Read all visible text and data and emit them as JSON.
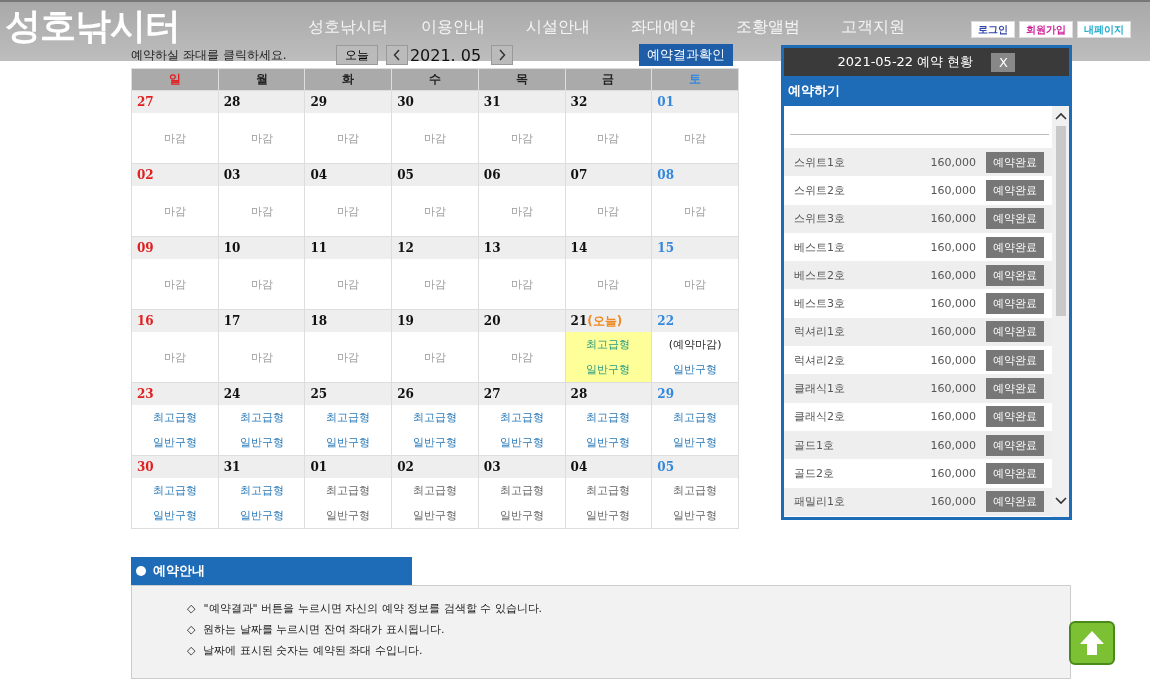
{
  "header": {
    "logo": "성호낚시터",
    "nav": [
      "성호낚시터",
      "이용안내",
      "시설안내",
      "좌대예약",
      "조황앨범",
      "고객지원"
    ],
    "account": [
      {
        "label": "로그인",
        "color": "#3344aa"
      },
      {
        "label": "회원가입",
        "color": "#cc2299"
      },
      {
        "label": "내페이지",
        "color": "#22aacc"
      }
    ]
  },
  "toolbar": {
    "hint": "예약하실 좌대를 클릭하세요.",
    "today_button": "오늘",
    "month": "2021. 05",
    "result_button": "예약결과확인"
  },
  "calendar": {
    "weekdays": [
      {
        "label": "일",
        "kind": "sun"
      },
      {
        "label": "월",
        "kind": "week"
      },
      {
        "label": "화",
        "kind": "week"
      },
      {
        "label": "수",
        "kind": "week"
      },
      {
        "label": "목",
        "kind": "week"
      },
      {
        "label": "금",
        "kind": "week"
      },
      {
        "label": "토",
        "kind": "sat"
      }
    ],
    "weeks": [
      [
        {
          "num": "27",
          "kind": "sun",
          "entries": [
            {
              "text": "마감",
              "kind": "closed"
            }
          ]
        },
        {
          "num": "28",
          "kind": "week",
          "entries": [
            {
              "text": "마감",
              "kind": "closed"
            }
          ]
        },
        {
          "num": "29",
          "kind": "week",
          "entries": [
            {
              "text": "마감",
              "kind": "closed"
            }
          ]
        },
        {
          "num": "30",
          "kind": "week",
          "entries": [
            {
              "text": "마감",
              "kind": "closed"
            }
          ]
        },
        {
          "num": "31",
          "kind": "week",
          "entries": [
            {
              "text": "마감",
              "kind": "closed"
            }
          ]
        },
        {
          "num": "32",
          "kind": "week",
          "entries": [
            {
              "text": "마감",
              "kind": "closed"
            }
          ]
        },
        {
          "num": "01",
          "kind": "sat",
          "entries": [
            {
              "text": "마감",
              "kind": "closed"
            }
          ]
        }
      ],
      [
        {
          "num": "02",
          "kind": "sun",
          "entries": [
            {
              "text": "마감",
              "kind": "closed"
            }
          ]
        },
        {
          "num": "03",
          "kind": "week",
          "entries": [
            {
              "text": "마감",
              "kind": "closed"
            }
          ]
        },
        {
          "num": "04",
          "kind": "week",
          "entries": [
            {
              "text": "마감",
              "kind": "closed"
            }
          ]
        },
        {
          "num": "05",
          "kind": "week",
          "entries": [
            {
              "text": "마감",
              "kind": "closed"
            }
          ]
        },
        {
          "num": "06",
          "kind": "week",
          "entries": [
            {
              "text": "마감",
              "kind": "closed"
            }
          ]
        },
        {
          "num": "07",
          "kind": "week",
          "entries": [
            {
              "text": "마감",
              "kind": "closed"
            }
          ]
        },
        {
          "num": "08",
          "kind": "sat",
          "entries": [
            {
              "text": "마감",
              "kind": "closed"
            }
          ]
        }
      ],
      [
        {
          "num": "09",
          "kind": "sun",
          "entries": [
            {
              "text": "마감",
              "kind": "closed"
            }
          ]
        },
        {
          "num": "10",
          "kind": "week",
          "entries": [
            {
              "text": "마감",
              "kind": "closed"
            }
          ]
        },
        {
          "num": "11",
          "kind": "week",
          "entries": [
            {
              "text": "마감",
              "kind": "closed"
            }
          ]
        },
        {
          "num": "12",
          "kind": "week",
          "entries": [
            {
              "text": "마감",
              "kind": "closed"
            }
          ]
        },
        {
          "num": "13",
          "kind": "week",
          "entries": [
            {
              "text": "마감",
              "kind": "closed"
            }
          ]
        },
        {
          "num": "14",
          "kind": "week",
          "entries": [
            {
              "text": "마감",
              "kind": "closed"
            }
          ]
        },
        {
          "num": "15",
          "kind": "sat",
          "entries": [
            {
              "text": "마감",
              "kind": "closed"
            }
          ]
        }
      ],
      [
        {
          "num": "16",
          "kind": "sun",
          "entries": [
            {
              "text": "마감",
              "kind": "closed"
            }
          ]
        },
        {
          "num": "17",
          "kind": "week",
          "entries": [
            {
              "text": "마감",
              "kind": "closed"
            }
          ]
        },
        {
          "num": "18",
          "kind": "week",
          "entries": [
            {
              "text": "마감",
              "kind": "closed"
            }
          ]
        },
        {
          "num": "19",
          "kind": "week",
          "entries": [
            {
              "text": "마감",
              "kind": "closed"
            }
          ]
        },
        {
          "num": "20",
          "kind": "week",
          "entries": [
            {
              "text": "마감",
              "kind": "closed"
            }
          ]
        },
        {
          "num": "21",
          "kind": "week",
          "today_label": "(오늘)",
          "today": true,
          "entries": [
            {
              "text": "최고급형",
              "kind": "open"
            },
            {
              "text": "일반구형",
              "kind": "open"
            }
          ]
        },
        {
          "num": "22",
          "kind": "sat",
          "entries": [
            {
              "text": "(예약마감)",
              "kind": "full"
            },
            {
              "text": "일반구형",
              "kind": "open"
            }
          ]
        }
      ],
      [
        {
          "num": "23",
          "kind": "sun",
          "entries": [
            {
              "text": "최고급형",
              "kind": "open"
            },
            {
              "text": "일반구형",
              "kind": "open"
            }
          ]
        },
        {
          "num": "24",
          "kind": "week",
          "entries": [
            {
              "text": "최고급형",
              "kind": "open"
            },
            {
              "text": "일반구형",
              "kind": "open"
            }
          ]
        },
        {
          "num": "25",
          "kind": "week",
          "entries": [
            {
              "text": "최고급형",
              "kind": "open"
            },
            {
              "text": "일반구형",
              "kind": "open"
            }
          ]
        },
        {
          "num": "26",
          "kind": "week",
          "entries": [
            {
              "text": "최고급형",
              "kind": "open"
            },
            {
              "text": "일반구형",
              "kind": "open"
            }
          ]
        },
        {
          "num": "27",
          "kind": "week",
          "entries": [
            {
              "text": "최고급형",
              "kind": "open"
            },
            {
              "text": "일반구형",
              "kind": "open"
            }
          ]
        },
        {
          "num": "28",
          "kind": "week",
          "entries": [
            {
              "text": "최고급형",
              "kind": "open"
            },
            {
              "text": "일반구형",
              "kind": "open"
            }
          ]
        },
        {
          "num": "29",
          "kind": "sat",
          "entries": [
            {
              "text": "최고급형",
              "kind": "open"
            },
            {
              "text": "일반구형",
              "kind": "open"
            }
          ]
        }
      ],
      [
        {
          "num": "30",
          "kind": "sun",
          "entries": [
            {
              "text": "최고급형",
              "kind": "open"
            },
            {
              "text": "일반구형",
              "kind": "open"
            }
          ]
        },
        {
          "num": "31",
          "kind": "week",
          "entries": [
            {
              "text": "최고급형",
              "kind": "open"
            },
            {
              "text": "일반구형",
              "kind": "open"
            }
          ]
        },
        {
          "num": "01",
          "kind": "week",
          "entries": [
            {
              "text": "최고급형",
              "kind": "future"
            },
            {
              "text": "일반구형",
              "kind": "future"
            }
          ]
        },
        {
          "num": "02",
          "kind": "week",
          "entries": [
            {
              "text": "최고급형",
              "kind": "future"
            },
            {
              "text": "일반구형",
              "kind": "future"
            }
          ]
        },
        {
          "num": "03",
          "kind": "week",
          "entries": [
            {
              "text": "최고급형",
              "kind": "future"
            },
            {
              "text": "일반구형",
              "kind": "future"
            }
          ]
        },
        {
          "num": "04",
          "kind": "week",
          "entries": [
            {
              "text": "최고급형",
              "kind": "future"
            },
            {
              "text": "일반구형",
              "kind": "future"
            }
          ]
        },
        {
          "num": "05",
          "kind": "sat",
          "entries": [
            {
              "text": "최고급형",
              "kind": "future"
            },
            {
              "text": "일반구형",
              "kind": "future"
            }
          ]
        }
      ]
    ]
  },
  "popup": {
    "title": "2021-05-22 예약 현황",
    "close": "X",
    "section": "예약하기",
    "rooms": [
      {
        "name": "스위트1호",
        "price": "160,000",
        "status": "예약완료"
      },
      {
        "name": "스위트2호",
        "price": "160,000",
        "status": "예약완료"
      },
      {
        "name": "스위트3호",
        "price": "160,000",
        "status": "예약완료"
      },
      {
        "name": "베스트1호",
        "price": "160,000",
        "status": "예약완료"
      },
      {
        "name": "베스트2호",
        "price": "160,000",
        "status": "예약완료"
      },
      {
        "name": "베스트3호",
        "price": "160,000",
        "status": "예약완료"
      },
      {
        "name": "럭셔리1호",
        "price": "160,000",
        "status": "예약완료"
      },
      {
        "name": "럭셔리2호",
        "price": "160,000",
        "status": "예약완료"
      },
      {
        "name": "클래식1호",
        "price": "160,000",
        "status": "예약완료"
      },
      {
        "name": "클래식2호",
        "price": "160,000",
        "status": "예약완료"
      },
      {
        "name": "골드1호",
        "price": "160,000",
        "status": "예약완료"
      },
      {
        "name": "골드2호",
        "price": "160,000",
        "status": "예약완료"
      },
      {
        "name": "패밀리1호",
        "price": "160,000",
        "status": "예약완료"
      }
    ]
  },
  "guide": {
    "title": "예약안내",
    "items": [
      {
        "bullet": "◇",
        "text": "\"예약결과\" 버튼을 누르시면 자신의 예약 정보를 검색할 수 있습니다."
      },
      {
        "bullet": "◇",
        "text": "원하는 날짜를 누르시면 잔여 좌대가 표시됩니다."
      },
      {
        "bullet": "◇",
        "text": "날짜에 표시된 숫자는 예약된 좌대 수입니다."
      }
    ]
  }
}
